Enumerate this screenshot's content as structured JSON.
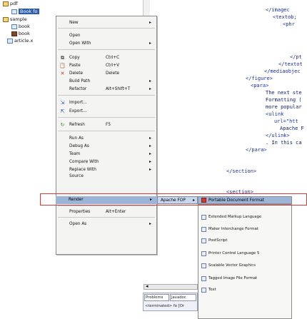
{
  "tree": {
    "items": [
      {
        "label": "pdf",
        "icon": "folder-icon"
      },
      {
        "label": "Book fo",
        "icon": "file-icon"
      },
      {
        "label": "sample",
        "icon": "folder-icon"
      },
      {
        "label": "book",
        "icon": "file-icon"
      },
      {
        "label": "book",
        "icon": "file-icon"
      },
      {
        "label": "article.x",
        "icon": "file-icon"
      }
    ]
  },
  "editor": {
    "lines": [
      "</imagec",
      "<textob;",
      "<phr",
      "</pt",
      "</textot",
      "</mediaobjec",
      "</figure>",
      "<para>",
      "The next ste",
      "Formatting (",
      "more popular",
      "<ulink",
      "url=\"htt",
      "Apache F",
      "</ulink>",
      ". In this ca",
      "</para>",
      "</section>",
      "<section>"
    ]
  },
  "menu": {
    "new": "New",
    "open": "Open",
    "open_with": "Open With",
    "copy": "Copy",
    "copy_acc": "Ctrl+C",
    "paste": "Paste",
    "paste_acc": "Ctrl+V",
    "delete": "Delete",
    "delete_acc": "Delete",
    "build_path": "Build Path",
    "refactor": "Refactor",
    "refactor_acc": "Alt+Shift+T",
    "import": "Import...",
    "export": "Export...",
    "refresh": "Refresh",
    "refresh_acc": "F5",
    "run_as": "Run As",
    "debug_as": "Debug As",
    "team": "Team",
    "compare_with": "Compare With",
    "replace_with": "Replace With",
    "source": "Source",
    "render": "Render",
    "properties": "Properties",
    "properties_acc": "Alt+Enter",
    "open_as": "Open As"
  },
  "submenu1": {
    "label": "Apache FOP"
  },
  "submenu2": {
    "highlighted": "Portable Document Format",
    "items": [
      "Extended Markup Language",
      "Maker Interchange Format",
      "PostScript",
      "Printer Control Language 5",
      "Scalable Vector Graphics",
      "Tagged Image File Format",
      "Text"
    ]
  },
  "views": {
    "tab1": "Problems",
    "tab2": "Javadoc",
    "status": "<terminated> fo [Or"
  }
}
